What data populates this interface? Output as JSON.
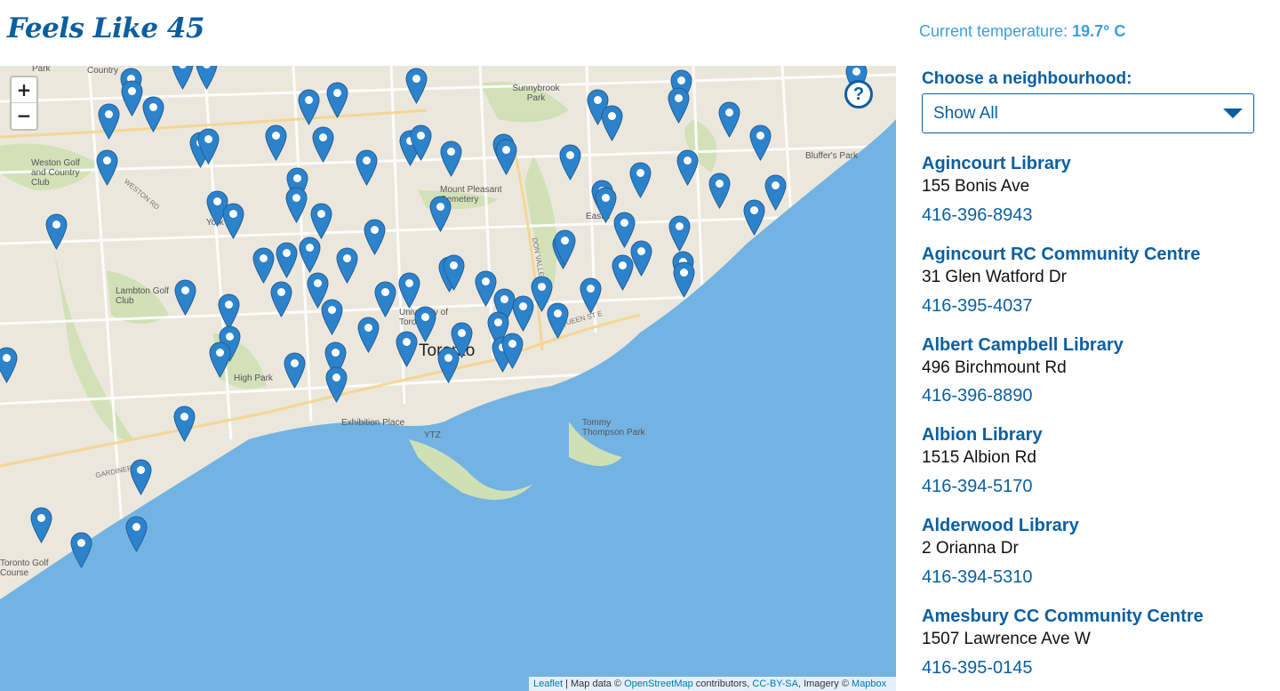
{
  "header": {
    "title": "Feels Like 45",
    "temperature_label": "Current temperature:",
    "temperature_value": "19.7° C"
  },
  "map": {
    "zoom_in": "+",
    "zoom_out": "−",
    "help_glyph": "?",
    "labels": {
      "toronto": "Toronto",
      "sunnybrook": "Sunnybrook Park",
      "mount_pleasant": "Mount Pleasant Cemetery",
      "weston_golf": "Weston Golf and Country Club",
      "lambton_golf": "Lambton Golf Club",
      "high_park": "High Park",
      "exhibition": "Exhibition Place",
      "tommy_thompson": "Tommy Thompson Park",
      "bluffers": "Bluffer's Park",
      "ytz": "YTZ",
      "uoft": "University of Toronto",
      "east_york": "East Y",
      "york": "York",
      "country": "Country",
      "park": "Park",
      "weston_rd": "WESTON RD",
      "gardiner": "GARDINER",
      "queen_st": "QUEEN ST E",
      "don_valley": "DON VALLEY PKWY",
      "toronto_golf": "Toronto Golf Course"
    },
    "attribution": {
      "leaflet": "Leaflet",
      "sep": " | Map data © ",
      "osm": "OpenStreetMap",
      "contributors": " contributors, ",
      "license": "CC-BY-SA",
      "imagery": ", Imagery © ",
      "mapbox": "Mapbox"
    }
  },
  "sidebar": {
    "choose_label": "Choose a neighbourhood:",
    "select_value": "Show All",
    "locations": [
      {
        "name": "Agincourt Library",
        "address": "155 Bonis Ave",
        "phone": "416-396-8943"
      },
      {
        "name": "Agincourt RC Community Centre",
        "address": "31 Glen Watford Dr",
        "phone": "416-395-4037"
      },
      {
        "name": "Albert Campbell Library",
        "address": "496 Birchmount Rd",
        "phone": "416-396-8890"
      },
      {
        "name": "Albion Library",
        "address": "1515 Albion Rd",
        "phone": "416-394-5170"
      },
      {
        "name": "Alderwood Library",
        "address": "2 Orianna Dr",
        "phone": "416-394-5310"
      },
      {
        "name": "Amesbury CC Community Centre",
        "address": "1507 Lawrence Ave W",
        "phone": "416-395-0145"
      }
    ]
  },
  "colors": {
    "brand": "#0b5fa0",
    "accent": "#3c9fde",
    "water": "#72b3e3",
    "land": "#ece7dc",
    "marker": "#2c83cb"
  }
}
